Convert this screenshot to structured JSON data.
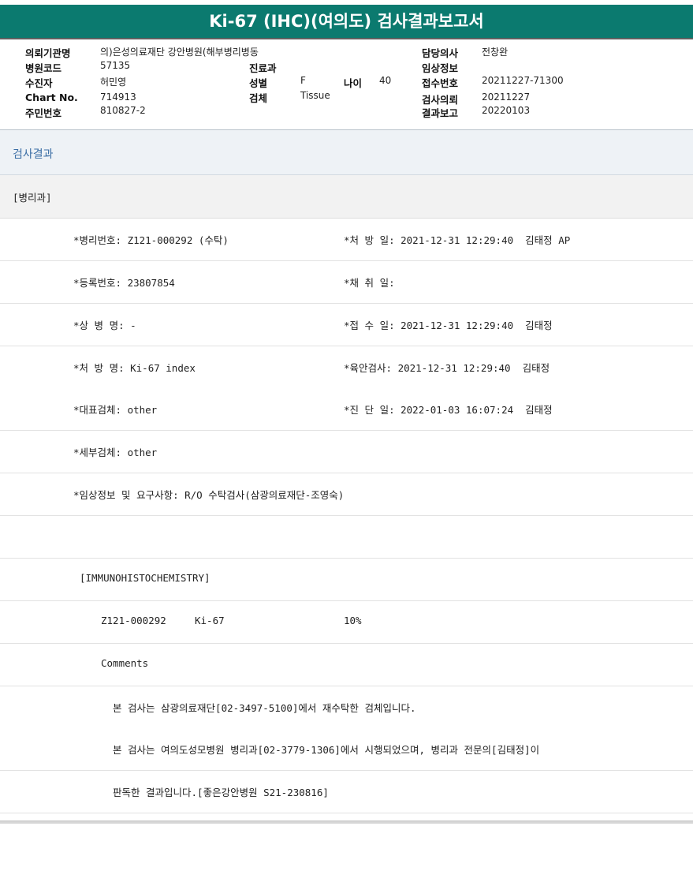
{
  "report": {
    "title": "Ki-67 (IHC)(여의도) 검사결과보고서"
  },
  "info": {
    "hospital_label": "의뢰기관명",
    "hospital_value": "의)은성의료재단 강안병원(해부병리병동",
    "code_label": "병원코드",
    "code_value": "57135",
    "patient_label": "수진자",
    "patient_value": "허민영",
    "chart_label": "Chart No.",
    "chart_value": "714913",
    "resident_label": "주민번호",
    "resident_value": "810827-2",
    "dept_label": "진료과",
    "dept_value": "",
    "sex_label": "성별",
    "sex_value": "F",
    "age_label": "나이",
    "age_value": "40",
    "specimen_label": "검체",
    "specimen_value": "Tissue",
    "doctor_label": "담당의사",
    "doctor_value": "전창완",
    "clinical_label": "임상정보",
    "clinical_value": "",
    "receipt_label": "접수번호",
    "receipt_value": "20211227-71300",
    "request_label": "검사의뢰",
    "request_value": "20211227",
    "result_label": "결과보고",
    "result_value": "20220103"
  },
  "section": {
    "title": "검사결과",
    "department": "[병리과]"
  },
  "rows": [
    {
      "left": "*병리번호: Z121-000292 (수탁)",
      "right": "*처 방 일: 2021-12-31 12:29:40  김태정 AP"
    },
    {
      "left": "*등록번호: 23807854",
      "right": "*채 취 일:"
    },
    {
      "left": "*상 병 명: -",
      "right": "*접 수 일: 2021-12-31 12:29:40  김태정"
    },
    {
      "left": "*처 방 명: Ki-67 index",
      "right": "*육안검사: 2021-12-31 12:29:40  김태정"
    },
    {
      "left": "*대표검체: other",
      "right": "*진 단 일: 2022-01-03 16:07:24  김태정"
    },
    {
      "left": "*세부검체: other",
      "right": ""
    },
    {
      "left": "*임상정보 및 요구사항: R/O 수탁검사(삼광의료재단-조영숙)",
      "right": ""
    },
    {
      "left": "",
      "right": ""
    },
    {
      "left": "[IMMUNOHISTOCHEMISTRY]",
      "right": ""
    }
  ],
  "ihc": {
    "id": "Z121-000292",
    "marker": "Ki-67",
    "value": "10%",
    "comments_label": "Comments",
    "comment_1": "본 검사는 삼광의료재단[02-3497-5100]에서 재수탁한 검체입니다.",
    "comment_2": "본 검사는 여의도성모병원 병리과[02-3779-1306]에서 시행되었으며, 병리과 전문의[김태정]이",
    "comment_3": "판독한 결과입니다.[좋은강안병원 S21-230816]"
  }
}
